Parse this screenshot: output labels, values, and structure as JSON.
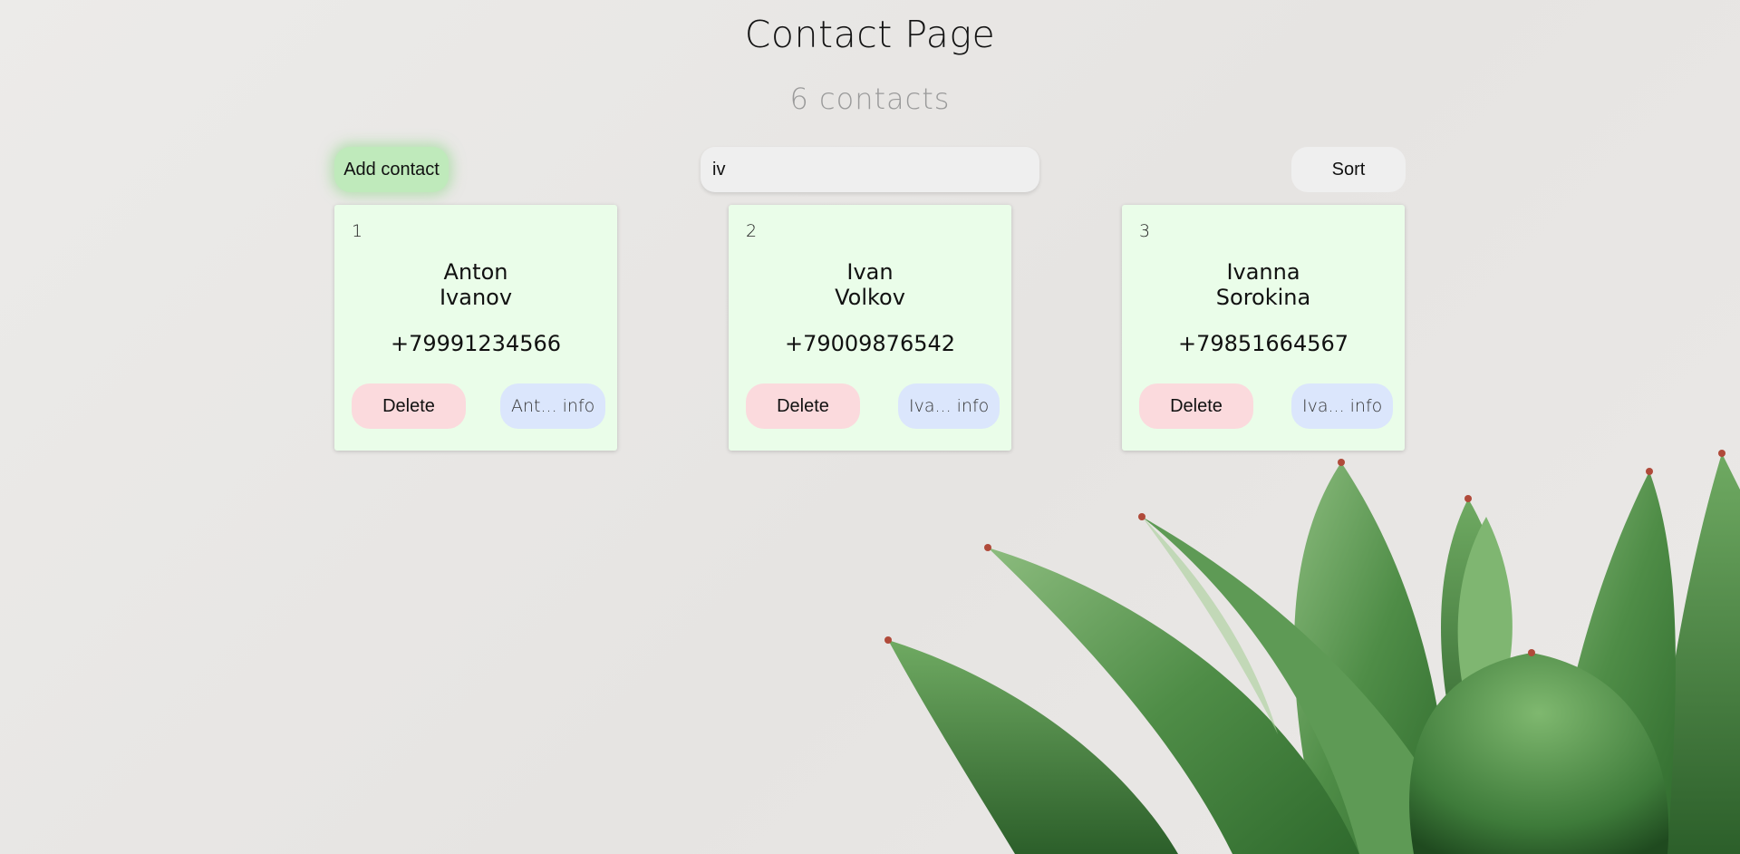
{
  "header": {
    "title": "Contact Page",
    "count_label": "6 contacts"
  },
  "toolbar": {
    "add_label": "Add contact",
    "search_value": "iv",
    "sort_label": "Sort"
  },
  "contacts": [
    {
      "index": "1",
      "first_name": "Anton",
      "last_name": "Ivanov",
      "phone": "+79991234566",
      "delete_label": "Delete",
      "info_label": "Ant... info"
    },
    {
      "index": "2",
      "first_name": "Ivan",
      "last_name": "Volkov",
      "phone": "+79009876542",
      "delete_label": "Delete",
      "info_label": "Iva... info"
    },
    {
      "index": "3",
      "first_name": "Ivanna",
      "last_name": "Sorokina",
      "phone": "+79851664567",
      "delete_label": "Delete",
      "info_label": "Iva... info"
    }
  ],
  "colors": {
    "background": "#e9e7e5",
    "card_background": "#eafde9",
    "add_button": "#bfeabb",
    "delete_button": "#fbdadd",
    "info_button": "#dbe6fc",
    "plant_green": "#4a8a45"
  },
  "decoration": {
    "background_image": "succulent-plant"
  }
}
